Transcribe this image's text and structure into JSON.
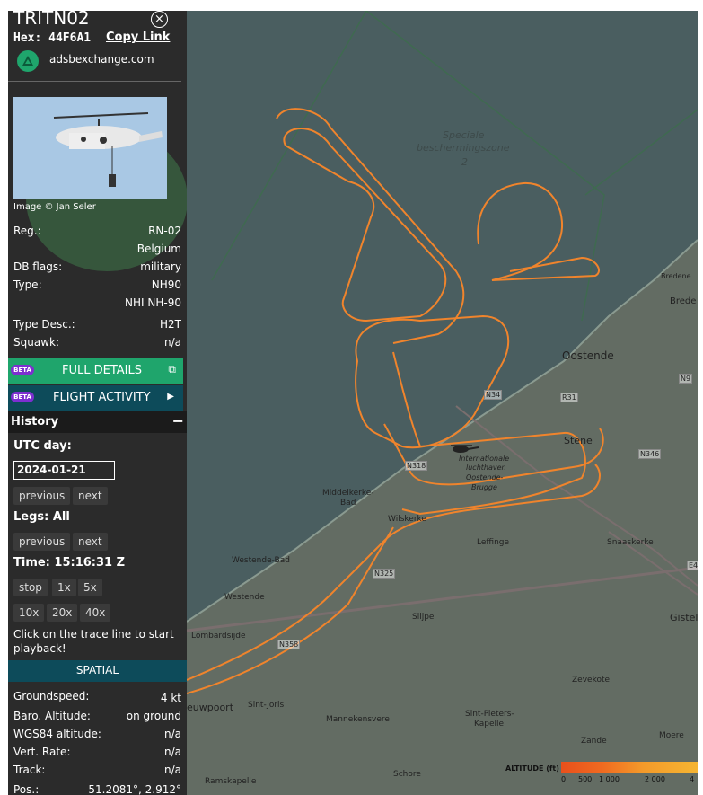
{
  "panel": {
    "title": "TRITN02",
    "hex_label": "Hex:",
    "hex_value": "44F6A1",
    "copy_link": "Copy Link",
    "site": "adsbexchange.com",
    "image_credit": "Image © Jan Seler",
    "details": [
      {
        "label": "Reg.:",
        "value": "RN-02"
      },
      {
        "label": "",
        "value": "Belgium"
      },
      {
        "label": "DB flags:",
        "value": "military"
      },
      {
        "label": "Type:",
        "value": "NH90"
      },
      {
        "label": "",
        "value": "NHI NH-90"
      },
      {
        "label": "Type Desc.:",
        "value": "H2T"
      },
      {
        "label": "Squawk:",
        "value": "n/a"
      }
    ],
    "beta": "BETA",
    "full_details": "FULL DETAILS",
    "flight_activity": "FLIGHT ACTIVITY",
    "history": "History",
    "history_toggle": "−",
    "utc_day_label": "UTC day:",
    "utc_day_value": "2024-01-21",
    "previous": "previous",
    "next": "next",
    "legs_label": "Legs: All",
    "time_label": "Time: 15:16:31 Z",
    "stop": "stop",
    "speeds": [
      "1x",
      "5x",
      "10x",
      "20x",
      "40x"
    ],
    "playback_hint": "Click on the trace line to start playback!",
    "spatial": "SPATIAL",
    "spatial_rows": [
      {
        "label": "Groundspeed:",
        "value": "4 kt"
      },
      {
        "label": "Baro. Altitude:",
        "value": "on ground"
      },
      {
        "label": "WGS84 altitude:",
        "value": "n/a"
      },
      {
        "label": "Vert. Rate:",
        "value": "n/a"
      },
      {
        "label": "Track:",
        "value": "n/a"
      },
      {
        "label": "Pos.:",
        "value": "51.2081°, 2.912°"
      }
    ]
  },
  "map": {
    "zone_label_1": "Speciale",
    "zone_label_2": "beschermingszone",
    "zone_label_3": "2",
    "places": [
      "Bredene",
      "Brede",
      "Oostende",
      "Stene",
      "Internationale",
      "luchthaven",
      "Oostende-",
      "Brugge",
      "Middelkerke-",
      "Bad",
      "Wilskerke",
      "Leffinge",
      "Snaaskerke",
      "Westende-Bad",
      "Westende",
      "Slijpe",
      "Gistel",
      "Lombardsijde",
      "Zevekote",
      "euwpoort",
      "Sint-Joris",
      "Mannekensvere",
      "Sint-Pieters-",
      "Kapelle",
      "Zande",
      "Moere",
      "Ramskapelle",
      "Schore"
    ],
    "roads": [
      "N34",
      "R31",
      "N9",
      "N346",
      "N318",
      "N325",
      "N358",
      "E4"
    ],
    "legend_title": "ALTITUDE (ft)",
    "legend_ticks": [
      "0",
      "500",
      "1 000",
      "2 000",
      "4"
    ]
  },
  "colors": {
    "panel_bg": "#2b2b2b",
    "map_sea": "#4a5e60",
    "map_land": "#5d6a6a",
    "track": "#f0842c",
    "full_details_bg": "#1fa56c",
    "flight_activity_bg": "#0d4b5a",
    "spatial_bg": "#0d4b5a"
  }
}
